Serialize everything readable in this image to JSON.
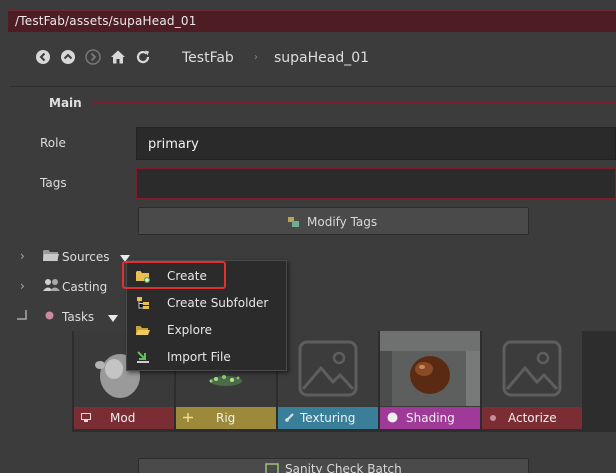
{
  "path": "/TestFab/assets/supaHead_01",
  "nav": {
    "breadcrumb_root": "TestFab",
    "breadcrumb_sep": "›",
    "breadcrumb_leaf": "supaHead_01"
  },
  "main": {
    "section_title": "Main",
    "role_label": "Role",
    "role_value": "primary",
    "tags_label": "Tags",
    "tags_value": "",
    "modify_tags_label": "Modify Tags"
  },
  "tree": {
    "sources_label": "Sources",
    "casting_label": "Casting",
    "tasks_label": "Tasks"
  },
  "context_menu": {
    "items": [
      {
        "label": "Create",
        "icon": "folder-plus-icon"
      },
      {
        "label": "Create Subfolder",
        "icon": "subfolder-icon"
      },
      {
        "label": "Explore",
        "icon": "open-folder-icon"
      },
      {
        "label": "Import File",
        "icon": "import-icon"
      }
    ]
  },
  "tasks": [
    {
      "label": "Mod",
      "color": "#7a2e33",
      "icon": "monitor-icon"
    },
    {
      "label": "Rig",
      "color": "#9c8a3a",
      "icon": "rig-icon"
    },
    {
      "label": "Texturing",
      "color": "#3a7f9a",
      "icon": "brush-icon"
    },
    {
      "label": "Shading",
      "color": "#a03a98",
      "icon": "sphere-icon"
    },
    {
      "label": "Actorize",
      "color": "#7a2e33",
      "icon": "dot-icon"
    }
  ],
  "bottom_button_label": "Sanity Check Batch",
  "colors": {
    "accent": "#7a1f2a",
    "background": "#3c3c3c",
    "highlight": "#e03030"
  }
}
